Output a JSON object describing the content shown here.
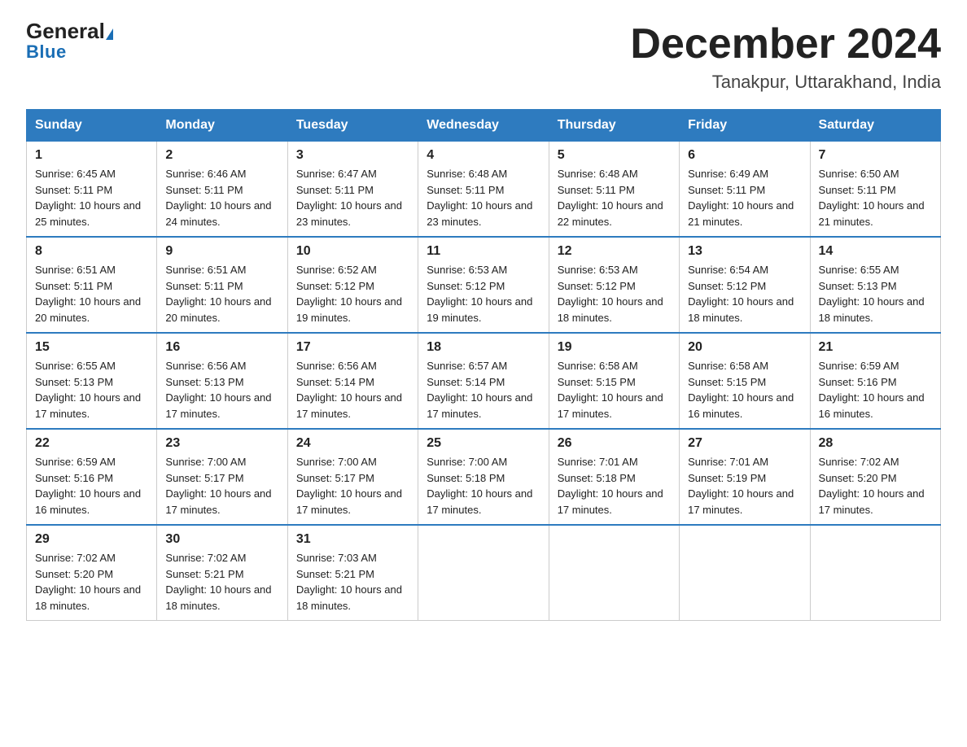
{
  "logo": {
    "general": "General",
    "blue": "Blue"
  },
  "title": "December 2024",
  "subtitle": "Tanakpur, Uttarakhand, India",
  "headers": [
    "Sunday",
    "Monday",
    "Tuesday",
    "Wednesday",
    "Thursday",
    "Friday",
    "Saturday"
  ],
  "weeks": [
    [
      {
        "day": "1",
        "sunrise": "Sunrise: 6:45 AM",
        "sunset": "Sunset: 5:11 PM",
        "daylight": "Daylight: 10 hours and 25 minutes."
      },
      {
        "day": "2",
        "sunrise": "Sunrise: 6:46 AM",
        "sunset": "Sunset: 5:11 PM",
        "daylight": "Daylight: 10 hours and 24 minutes."
      },
      {
        "day": "3",
        "sunrise": "Sunrise: 6:47 AM",
        "sunset": "Sunset: 5:11 PM",
        "daylight": "Daylight: 10 hours and 23 minutes."
      },
      {
        "day": "4",
        "sunrise": "Sunrise: 6:48 AM",
        "sunset": "Sunset: 5:11 PM",
        "daylight": "Daylight: 10 hours and 23 minutes."
      },
      {
        "day": "5",
        "sunrise": "Sunrise: 6:48 AM",
        "sunset": "Sunset: 5:11 PM",
        "daylight": "Daylight: 10 hours and 22 minutes."
      },
      {
        "day": "6",
        "sunrise": "Sunrise: 6:49 AM",
        "sunset": "Sunset: 5:11 PM",
        "daylight": "Daylight: 10 hours and 21 minutes."
      },
      {
        "day": "7",
        "sunrise": "Sunrise: 6:50 AM",
        "sunset": "Sunset: 5:11 PM",
        "daylight": "Daylight: 10 hours and 21 minutes."
      }
    ],
    [
      {
        "day": "8",
        "sunrise": "Sunrise: 6:51 AM",
        "sunset": "Sunset: 5:11 PM",
        "daylight": "Daylight: 10 hours and 20 minutes."
      },
      {
        "day": "9",
        "sunrise": "Sunrise: 6:51 AM",
        "sunset": "Sunset: 5:11 PM",
        "daylight": "Daylight: 10 hours and 20 minutes."
      },
      {
        "day": "10",
        "sunrise": "Sunrise: 6:52 AM",
        "sunset": "Sunset: 5:12 PM",
        "daylight": "Daylight: 10 hours and 19 minutes."
      },
      {
        "day": "11",
        "sunrise": "Sunrise: 6:53 AM",
        "sunset": "Sunset: 5:12 PM",
        "daylight": "Daylight: 10 hours and 19 minutes."
      },
      {
        "day": "12",
        "sunrise": "Sunrise: 6:53 AM",
        "sunset": "Sunset: 5:12 PM",
        "daylight": "Daylight: 10 hours and 18 minutes."
      },
      {
        "day": "13",
        "sunrise": "Sunrise: 6:54 AM",
        "sunset": "Sunset: 5:12 PM",
        "daylight": "Daylight: 10 hours and 18 minutes."
      },
      {
        "day": "14",
        "sunrise": "Sunrise: 6:55 AM",
        "sunset": "Sunset: 5:13 PM",
        "daylight": "Daylight: 10 hours and 18 minutes."
      }
    ],
    [
      {
        "day": "15",
        "sunrise": "Sunrise: 6:55 AM",
        "sunset": "Sunset: 5:13 PM",
        "daylight": "Daylight: 10 hours and 17 minutes."
      },
      {
        "day": "16",
        "sunrise": "Sunrise: 6:56 AM",
        "sunset": "Sunset: 5:13 PM",
        "daylight": "Daylight: 10 hours and 17 minutes."
      },
      {
        "day": "17",
        "sunrise": "Sunrise: 6:56 AM",
        "sunset": "Sunset: 5:14 PM",
        "daylight": "Daylight: 10 hours and 17 minutes."
      },
      {
        "day": "18",
        "sunrise": "Sunrise: 6:57 AM",
        "sunset": "Sunset: 5:14 PM",
        "daylight": "Daylight: 10 hours and 17 minutes."
      },
      {
        "day": "19",
        "sunrise": "Sunrise: 6:58 AM",
        "sunset": "Sunset: 5:15 PM",
        "daylight": "Daylight: 10 hours and 17 minutes."
      },
      {
        "day": "20",
        "sunrise": "Sunrise: 6:58 AM",
        "sunset": "Sunset: 5:15 PM",
        "daylight": "Daylight: 10 hours and 16 minutes."
      },
      {
        "day": "21",
        "sunrise": "Sunrise: 6:59 AM",
        "sunset": "Sunset: 5:16 PM",
        "daylight": "Daylight: 10 hours and 16 minutes."
      }
    ],
    [
      {
        "day": "22",
        "sunrise": "Sunrise: 6:59 AM",
        "sunset": "Sunset: 5:16 PM",
        "daylight": "Daylight: 10 hours and 16 minutes."
      },
      {
        "day": "23",
        "sunrise": "Sunrise: 7:00 AM",
        "sunset": "Sunset: 5:17 PM",
        "daylight": "Daylight: 10 hours and 17 minutes."
      },
      {
        "day": "24",
        "sunrise": "Sunrise: 7:00 AM",
        "sunset": "Sunset: 5:17 PM",
        "daylight": "Daylight: 10 hours and 17 minutes."
      },
      {
        "day": "25",
        "sunrise": "Sunrise: 7:00 AM",
        "sunset": "Sunset: 5:18 PM",
        "daylight": "Daylight: 10 hours and 17 minutes."
      },
      {
        "day": "26",
        "sunrise": "Sunrise: 7:01 AM",
        "sunset": "Sunset: 5:18 PM",
        "daylight": "Daylight: 10 hours and 17 minutes."
      },
      {
        "day": "27",
        "sunrise": "Sunrise: 7:01 AM",
        "sunset": "Sunset: 5:19 PM",
        "daylight": "Daylight: 10 hours and 17 minutes."
      },
      {
        "day": "28",
        "sunrise": "Sunrise: 7:02 AM",
        "sunset": "Sunset: 5:20 PM",
        "daylight": "Daylight: 10 hours and 17 minutes."
      }
    ],
    [
      {
        "day": "29",
        "sunrise": "Sunrise: 7:02 AM",
        "sunset": "Sunset: 5:20 PM",
        "daylight": "Daylight: 10 hours and 18 minutes."
      },
      {
        "day": "30",
        "sunrise": "Sunrise: 7:02 AM",
        "sunset": "Sunset: 5:21 PM",
        "daylight": "Daylight: 10 hours and 18 minutes."
      },
      {
        "day": "31",
        "sunrise": "Sunrise: 7:03 AM",
        "sunset": "Sunset: 5:21 PM",
        "daylight": "Daylight: 10 hours and 18 minutes."
      },
      null,
      null,
      null,
      null
    ]
  ]
}
